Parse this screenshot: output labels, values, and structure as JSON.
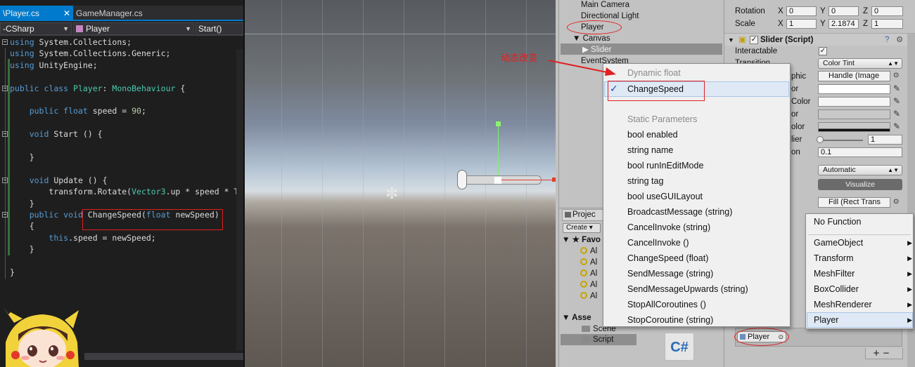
{
  "editor": {
    "tabs": [
      {
        "label": "\\Player.cs",
        "close": "✕"
      },
      {
        "label": "GameManager.cs"
      }
    ],
    "nav": {
      "project": "-CSharp",
      "class": "Player",
      "member": "Start()"
    },
    "code_lines": [
      {
        "parts": [
          [
            "kw",
            "using"
          ],
          [
            "",
            "System.Collections;"
          ]
        ]
      },
      {
        "parts": [
          [
            "kw",
            "using"
          ],
          [
            "",
            "System.Collections.Generic;"
          ]
        ]
      },
      {
        "parts": [
          [
            "kw",
            "using"
          ],
          [
            "",
            "UnityEngine;"
          ]
        ]
      },
      {
        "parts": []
      },
      {
        "parts": [
          [
            "kw",
            "public"
          ],
          [
            "kw",
            "class"
          ],
          [
            "ty",
            "Player"
          ],
          [
            "",
            ":"
          ],
          [
            "ty",
            "MonoBehaviour"
          ],
          [
            "",
            "{"
          ]
        ]
      },
      {
        "parts": []
      },
      {
        "parts": [
          [
            "",
            "    "
          ],
          [
            "kw",
            "public"
          ],
          [
            "kw",
            "float"
          ],
          [
            "",
            "speed ="
          ],
          [
            "nm",
            "90"
          ],
          [
            "",
            ";"
          ]
        ]
      },
      {
        "parts": []
      },
      {
        "parts": [
          [
            "",
            "    "
          ],
          [
            "kw",
            "void"
          ],
          [
            "",
            "Start () {"
          ]
        ]
      },
      {
        "parts": []
      },
      {
        "parts": [
          [
            "",
            "    }"
          ]
        ]
      },
      {
        "parts": []
      },
      {
        "parts": [
          [
            "",
            "    "
          ],
          [
            "kw",
            "void"
          ],
          [
            "",
            "Update () {"
          ]
        ]
      },
      {
        "parts": [
          [
            "",
            "        transform.Rotate("
          ],
          [
            "ty",
            "Vector3"
          ],
          [
            "",
            ".up * speed * Tim"
          ]
        ]
      },
      {
        "parts": [
          [
            "",
            "    }"
          ]
        ]
      },
      {
        "parts": [
          [
            "",
            "    "
          ],
          [
            "kw",
            "public"
          ],
          [
            "kw",
            "void"
          ],
          [
            "",
            "ChangeSpeed("
          ],
          [
            "kw",
            "float"
          ],
          [
            "",
            "newSpeed)"
          ]
        ]
      },
      {
        "parts": [
          [
            "",
            "    {"
          ]
        ]
      },
      {
        "parts": [
          [
            "",
            "        "
          ],
          [
            "kw",
            "this"
          ],
          [
            "",
            ".speed = newSpeed;"
          ]
        ]
      },
      {
        "parts": [
          [
            "",
            "    }"
          ]
        ]
      },
      {
        "parts": []
      },
      {
        "parts": [
          [
            "",
            "}"
          ]
        ]
      }
    ]
  },
  "hierarchy": {
    "items": [
      "Main Camera",
      "Directional Light",
      "Player",
      "▼ Canvas",
      "▶ Slider",
      "EventSystem"
    ]
  },
  "project": {
    "tab": "Projec",
    "create": "Create ▾",
    "favorites_label": "▼ ★ Favo",
    "fav_items": [
      "Al",
      "Al",
      "Al",
      "Al",
      "Al"
    ],
    "assets_label": "▼ Asse",
    "asset_items": [
      "Scene",
      "Script"
    ],
    "cs_icon": "C#"
  },
  "inspector": {
    "rotation_label": "Rotation",
    "scale_label": "Scale",
    "rotation": {
      "x": "0",
      "y": "0",
      "z": "0"
    },
    "scale": {
      "x": "1",
      "y": "2.1874",
      "z": "1"
    },
    "axis_x": "X",
    "axis_y": "Y",
    "axis_z": "Z",
    "component_title": "Slider (Script)",
    "interactable_label": "Interactable",
    "transition_label": "Transition",
    "transition_value": "Color Tint",
    "graphic_label": "phic",
    "graphic_value": "Handle (Image",
    "color_labels": [
      "or",
      "Color",
      "or",
      "olor"
    ],
    "multiplier_label": "lier",
    "multiplier_value": "1",
    "fade_label": "on",
    "fade_value": "0.1",
    "navigation_value": "Automatic",
    "visualize": "Visualize",
    "fill_value": "Fill (Rect Trans",
    "player_field": "Player",
    "plus_minus": "+  −"
  },
  "menu": {
    "dynamic_header": "Dynamic float",
    "dynamic_item": "ChangeSpeed",
    "check": "✓",
    "static_header": "Static Parameters",
    "static_items": [
      "bool enabled",
      "string name",
      "bool runInEditMode",
      "string tag",
      "bool useGUILayout",
      "BroadcastMessage (string)",
      "CancelInvoke (string)",
      "CancelInvoke ()",
      "ChangeSpeed (float)",
      "SendMessage (string)",
      "SendMessageUpwards (string)",
      "StopAllCoroutines ()",
      "StopCoroutine (string)"
    ]
  },
  "submenu": {
    "items": [
      {
        "label": "No Function",
        "arrow": ""
      },
      {
        "label": "GameObject",
        "arrow": "▶"
      },
      {
        "label": "Transform",
        "arrow": "▶"
      },
      {
        "label": "MeshFilter",
        "arrow": "▶"
      },
      {
        "label": "BoxCollider",
        "arrow": "▶"
      },
      {
        "label": "MeshRenderer",
        "arrow": "▶"
      },
      {
        "label": "Player",
        "arrow": "▶"
      }
    ]
  },
  "annotation": "动态改变",
  "scene": {
    "light_icon": "✼"
  }
}
